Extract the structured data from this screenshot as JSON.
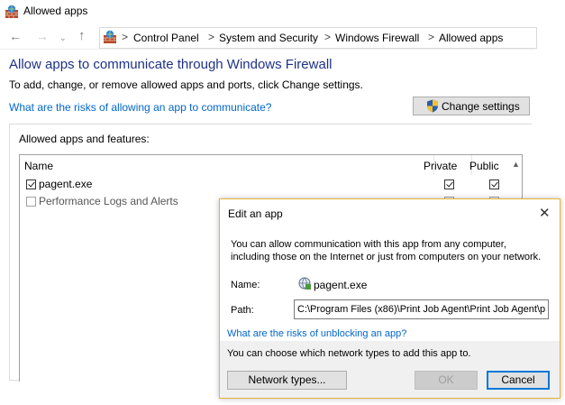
{
  "window": {
    "title": "Allowed apps"
  },
  "breadcrumbs": [
    "Control Panel",
    "System and Security",
    "Windows Firewall",
    "Allowed apps"
  ],
  "nav": {
    "back": "←",
    "forward": "→",
    "recent": "⌄",
    "up": "↑",
    "separator": ">"
  },
  "main": {
    "heading": "Allow apps to communicate through Windows Firewall",
    "subtext": "To add, change, or remove allowed apps and ports, click Change settings.",
    "risk_link": "What are the risks of allowing an app to communicate?",
    "change_settings_label": "Change settings"
  },
  "apps": {
    "group_label": "Allowed apps and features:",
    "columns": {
      "name": "Name",
      "private": "Private",
      "public": "Public"
    },
    "rows": [
      {
        "name": "pagent.exe",
        "enabled": true,
        "private": true,
        "public": true
      },
      {
        "name": "Performance Logs and Alerts",
        "enabled": false,
        "private": false,
        "public": false
      }
    ]
  },
  "dialog": {
    "title": "Edit an app",
    "close": "✕",
    "description": "You can allow communication with this app from any computer, including those on the Internet or just from computers on your network.",
    "name_label": "Name:",
    "name_value": "pagent.exe",
    "path_label": "Path:",
    "path_value": "C:\\Program Files (x86)\\Print Job Agent\\Print Job Agent\\p",
    "risk_link": "What are the risks of unblocking an app?",
    "choose_text": "You can choose which network types to add this app to.",
    "network_types_label": "Network types...",
    "ok_label": "OK",
    "cancel_label": "Cancel"
  },
  "colors": {
    "heading": "#1e3287",
    "link": "#0066cc",
    "dialog_border": "#e6b33a",
    "focus": "#0078d7"
  },
  "icons": {
    "title": "firewall-icon",
    "address": "firewall-icon",
    "change_settings": "uac-shield-icon",
    "app": "app-globe-icon"
  }
}
